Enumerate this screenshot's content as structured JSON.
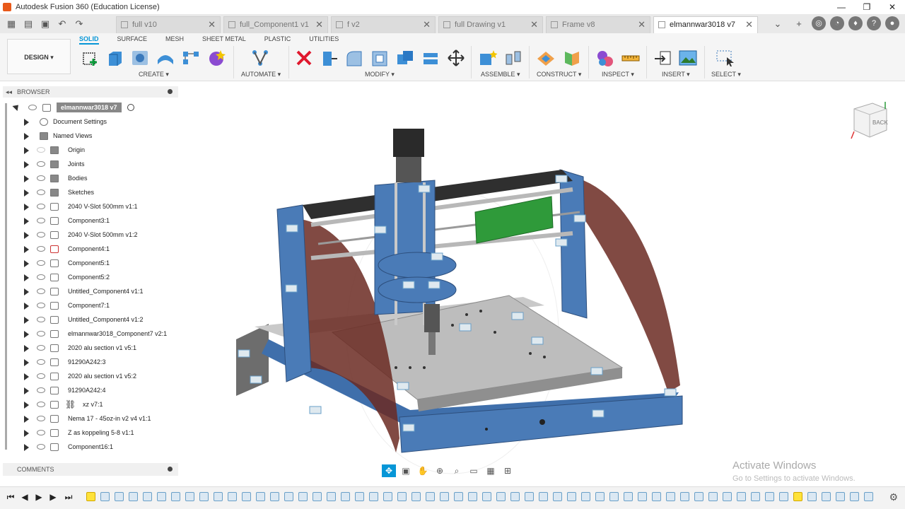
{
  "app": {
    "title": "Autodesk Fusion 360 (Education License)",
    "window_controls": [
      "—",
      "❐",
      "✕"
    ]
  },
  "tabs": [
    {
      "label": "full v10"
    },
    {
      "label": "full_Component1 v1"
    },
    {
      "label": "f v2"
    },
    {
      "label": "full Drawing v1"
    },
    {
      "label": "Frame v8"
    },
    {
      "label": "elmannwar3018 v7",
      "active": true
    }
  ],
  "ribbon": {
    "workspace": "DESIGN ▾",
    "tabs": [
      "SOLID",
      "SURFACE",
      "MESH",
      "SHEET METAL",
      "PLASTIC",
      "UTILITIES"
    ],
    "active_tab": "SOLID",
    "groups": [
      "CREATE ▾",
      "AUTOMATE ▾",
      "MODIFY ▾",
      "ASSEMBLE ▾",
      "CONSTRUCT ▾",
      "INSPECT ▾",
      "INSERT ▾",
      "SELECT ▾"
    ]
  },
  "browser": {
    "title": "BROWSER",
    "root": "elmannwar3018 v7",
    "items": [
      {
        "label": "Document Settings",
        "kind": "settings"
      },
      {
        "label": "Named Views",
        "kind": "views"
      },
      {
        "label": "Origin",
        "kind": "folder"
      },
      {
        "label": "Joints",
        "kind": "folder"
      },
      {
        "label": "Bodies",
        "kind": "folder"
      },
      {
        "label": "Sketches",
        "kind": "folder"
      },
      {
        "label": "2040 V-Slot 500mm v1:1",
        "kind": "component"
      },
      {
        "label": "Component3:1",
        "kind": "component"
      },
      {
        "label": "2040 V-Slot 500mm v1:2",
        "kind": "component"
      },
      {
        "label": "Component4:1",
        "kind": "component"
      },
      {
        "label": "Component5:1",
        "kind": "component"
      },
      {
        "label": "Component5:2",
        "kind": "component"
      },
      {
        "label": "Untitled_Component4 v1:1",
        "kind": "component"
      },
      {
        "label": "Component7:1",
        "kind": "component"
      },
      {
        "label": "Untitled_Component4 v1:2",
        "kind": "component"
      },
      {
        "label": "elmannwar3018_Component7 v2:1",
        "kind": "component"
      },
      {
        "label": "2020 alu section v1 v5:1",
        "kind": "component"
      },
      {
        "label": "91290A242:3",
        "kind": "component"
      },
      {
        "label": "2020 alu section v1 v5:2",
        "kind": "component"
      },
      {
        "label": "91290A242:4",
        "kind": "component"
      },
      {
        "label": "xz v7:1",
        "kind": "linked"
      },
      {
        "label": "Nema 17 - 45oz-in v2 v4 v1:1",
        "kind": "component"
      },
      {
        "label": "Z as koppeling 5-8 v1:1",
        "kind": "component"
      },
      {
        "label": "Component16:1",
        "kind": "component"
      }
    ]
  },
  "comments": {
    "title": "COMMENTS"
  },
  "viewcube": {
    "face": "BACK"
  },
  "watermark": {
    "line1": "Activate Windows",
    "line2": "Go to Settings to activate Windows."
  },
  "colors": {
    "accent": "#0696d7",
    "frame_blue": "#4a7bb7",
    "side_panel": "#6b2a22",
    "bed": "#bdbdbd"
  },
  "icons": {
    "viewport_icon": "cnc-router-3d-model",
    "timeline_highlight": "sketch-feature"
  }
}
